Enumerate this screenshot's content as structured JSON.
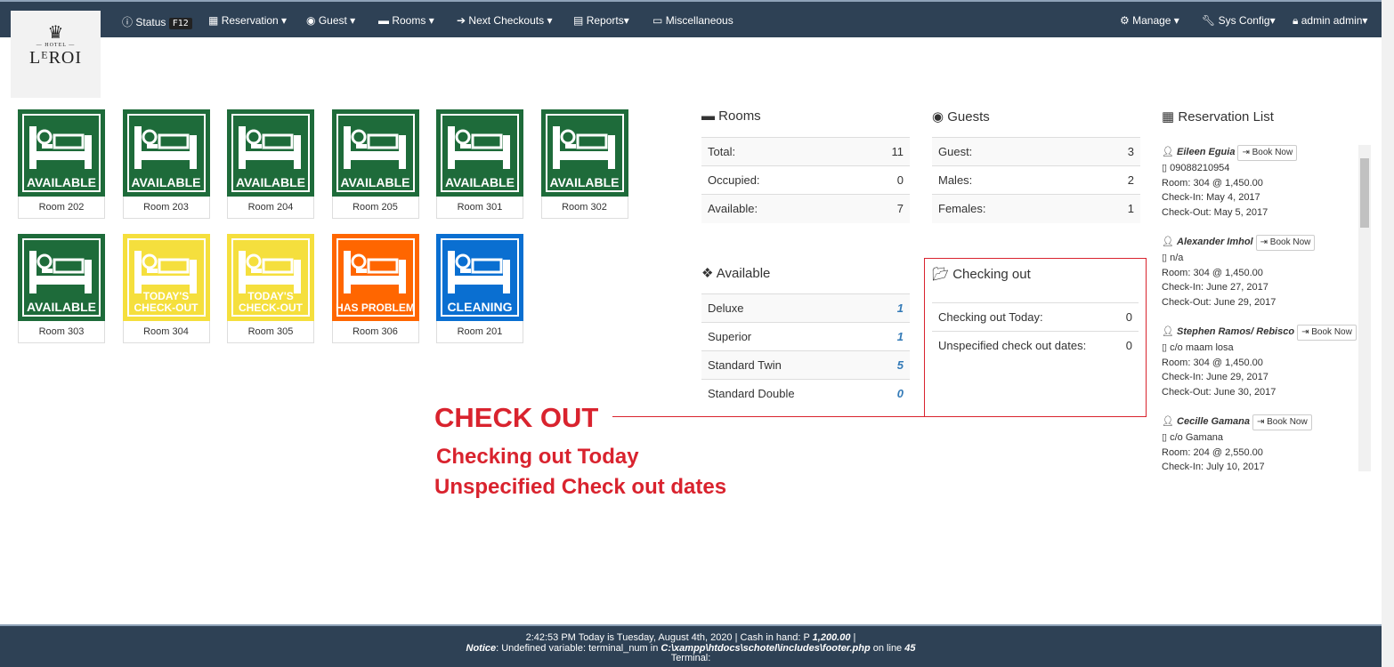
{
  "nav": {
    "status": "Status",
    "status_key": "F12",
    "reservation": "Reservation ▾",
    "guest": "Guest ▾",
    "rooms": "Rooms ▾",
    "next_checkouts": "Next Checkouts ▾",
    "reports": "Reports▾",
    "misc": "Miscellaneous",
    "manage": "Manage ▾",
    "sysconfig": "Sys Config▾",
    "user": "admin admin▾"
  },
  "logo": {
    "hotel": "— HOTEL —",
    "name": "LᴱROI"
  },
  "rooms": [
    {
      "room": "Room 202",
      "status": "AVAILABLE",
      "color": "#1e6b3a"
    },
    {
      "room": "Room 203",
      "status": "AVAILABLE",
      "color": "#1e6b3a"
    },
    {
      "room": "Room 204",
      "status": "AVAILABLE",
      "color": "#1e6b3a"
    },
    {
      "room": "Room 205",
      "status": "AVAILABLE",
      "color": "#1e6b3a"
    },
    {
      "room": "Room 301",
      "status": "AVAILABLE",
      "color": "#1e6b3a"
    },
    {
      "room": "Room 302",
      "status": "AVAILABLE",
      "color": "#1e6b3a"
    },
    {
      "room": "Room 303",
      "status": "AVAILABLE",
      "color": "#1e6b3a"
    },
    {
      "room": "Room 304",
      "status": "TODAY'S CHECK-OUT",
      "color": "#f5df3d"
    },
    {
      "room": "Room 305",
      "status": "TODAY'S CHECK-OUT",
      "color": "#f5df3d"
    },
    {
      "room": "Room 306",
      "status": "HAS PROBLEM",
      "color": "#ff6600"
    },
    {
      "room": "Room 201",
      "status": "CLEANING",
      "color": "#0a6fd1"
    }
  ],
  "rooms_panel": {
    "title": "Rooms",
    "rows": [
      {
        "label": "Total:",
        "value": "11"
      },
      {
        "label": "Occupied:",
        "value": "0"
      },
      {
        "label": "Available:",
        "value": "7"
      }
    ]
  },
  "guests_panel": {
    "title": "Guests",
    "rows": [
      {
        "label": "Guest:",
        "value": "3"
      },
      {
        "label": "Males:",
        "value": "2"
      },
      {
        "label": "Females:",
        "value": "1"
      }
    ]
  },
  "available_panel": {
    "title": "Available",
    "rows": [
      {
        "label": "Deluxe",
        "value": "1"
      },
      {
        "label": "Superior",
        "value": "1"
      },
      {
        "label": "Standard Twin",
        "value": "5"
      },
      {
        "label": "Standard Double",
        "value": "0"
      }
    ]
  },
  "checkout_panel": {
    "title": "Checking out",
    "rows": [
      {
        "label": "Checking out Today:",
        "value": "0"
      },
      {
        "label": "Unspecified check out dates:",
        "value": "0"
      }
    ]
  },
  "reservations": {
    "title": "Reservation List",
    "book_label": "Book Now",
    "entries": [
      {
        "name": "Eileen Eguia",
        "contact": "09088210954",
        "room": "Room: 304 @ 1,450.00",
        "checkin": "Check-In: May 4, 2017",
        "checkout": "Check-Out: May 5, 2017"
      },
      {
        "name": "Alexander Imhol",
        "contact": "n/a",
        "room": "Room: 304 @ 1,450.00",
        "checkin": "Check-In: June 27, 2017",
        "checkout": "Check-Out: June 29, 2017"
      },
      {
        "name": "Stephen Ramos/ Rebisco",
        "contact": "c/o maam losa",
        "room": "Room: 304 @ 1,450.00",
        "checkin": "Check-In: June 29, 2017",
        "checkout": "Check-Out: June 30, 2017"
      },
      {
        "name": "Cecille Gamana",
        "contact": "c/o Gamana",
        "room": "Room: 204 @ 2,550.00",
        "checkin": "Check-In: July 10, 2017",
        "checkout": ""
      }
    ]
  },
  "annotation": {
    "title": "CHECK OUT",
    "line1": "Checking out Today",
    "line2": "Unspecified Check out dates",
    "color": "#d9232e"
  },
  "footer": {
    "line1_a": "2:42:53 PM Today is Tuesday, August 4th, 2020 | Cash in hand: P ",
    "cash": "1,200.00",
    "line1_b": " |",
    "notice": "Notice",
    "notice_text": ": Undefined variable: terminal_num in ",
    "path": "C:\\xampp\\htdocs\\schotel\\includes\\footer.php",
    "on_line": " on line ",
    "line": "45",
    "terminal": "Terminal:"
  }
}
